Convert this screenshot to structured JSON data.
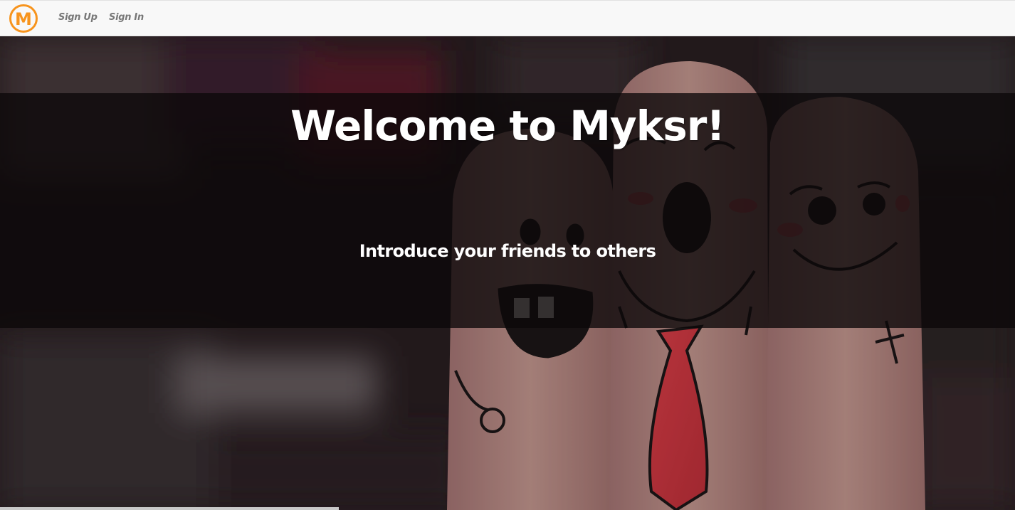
{
  "navbar": {
    "logo_letter": "M",
    "brand_color": "#f7941d",
    "links": [
      {
        "label": "Sign Up"
      },
      {
        "label": "Sign In"
      }
    ]
  },
  "hero": {
    "headline": "Welcome to Myksr!",
    "subheadline": "Introduce your friends to others",
    "background": "blurred photo of three fingers with drawn smiley faces, one wearing a red tie",
    "tie_color": "#e0404a"
  }
}
